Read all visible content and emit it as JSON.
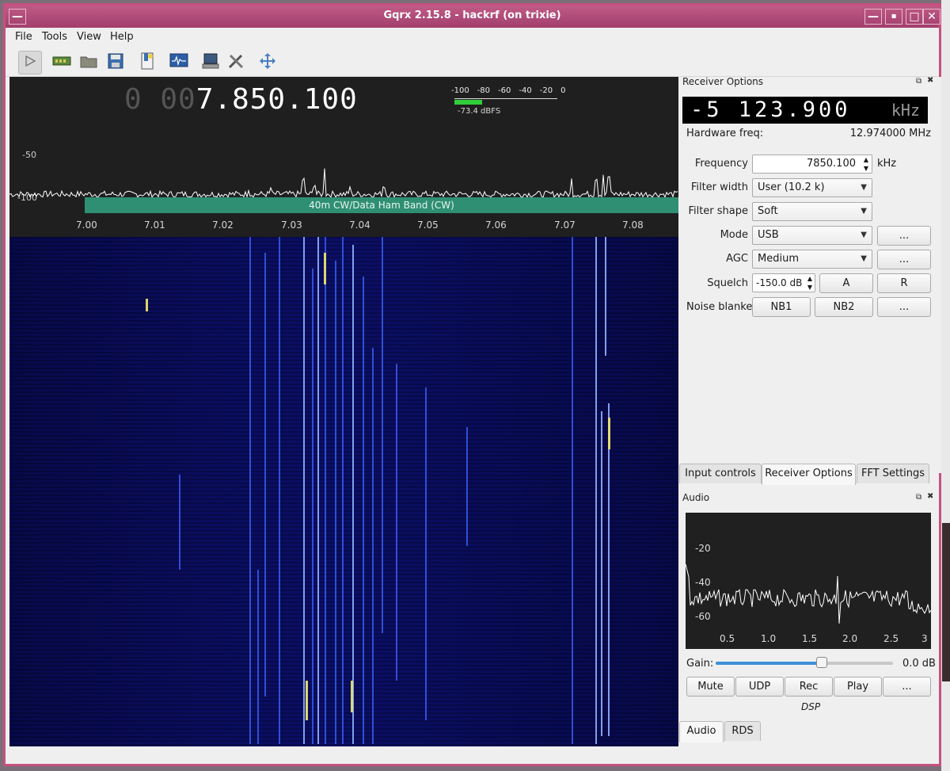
{
  "window": {
    "title": "Gqrx 2.15.8 - hackrf (on trixie)"
  },
  "menu": {
    "items": [
      "File",
      "Tools",
      "View",
      "Help"
    ]
  },
  "toolbar": {
    "icons": [
      "play-icon",
      "hardware-icon",
      "open-file-icon",
      "save-icon",
      "bookmark-icon",
      "scope-icon",
      "network-icon",
      "settings-icon",
      "fullscreen-icon"
    ]
  },
  "plot": {
    "frequency_dim": "0 00",
    "frequency_main": "7.850.100",
    "meter_scale": [
      "-100",
      "-80",
      "-60",
      "-40",
      "-20",
      "0"
    ],
    "meter_level": 0.27,
    "meter_text": "-73.4 dBFS",
    "db_labels": [
      "-50",
      "-100"
    ],
    "band_label": "40m CW/Data Ham Band (CW)",
    "freq_ticks": [
      "7.00",
      "7.01",
      "7.02",
      "7.03",
      "7.04",
      "7.05",
      "7.06",
      "7.07",
      "7.08"
    ]
  },
  "receiver": {
    "panel_title": "Receiver Options",
    "lcd_value": "-5 123.900",
    "lcd_unit": "kHz",
    "hardware_label": "Hardware freq:",
    "hardware_value": "12.974000 MHz",
    "frequency_label": "Frequency",
    "frequency_value": "7850.100",
    "frequency_unit": "kHz",
    "filter_width_label": "Filter width",
    "filter_width_value": "User (10.2 k)",
    "filter_shape_label": "Filter shape",
    "filter_shape_value": "Soft",
    "mode_label": "Mode",
    "mode_value": "USB",
    "agc_label": "AGC",
    "agc_value": "Medium",
    "squelch_label": "Squelch",
    "squelch_value": "-150.0 dB",
    "squelch_a": "A",
    "squelch_r": "R",
    "noise_label": "Noise blanker",
    "nb1": "NB1",
    "nb2": "NB2",
    "more": "..."
  },
  "dock_tabs": [
    "Input controls",
    "Receiver Options",
    "FFT Settings"
  ],
  "audio": {
    "panel_title": "Audio",
    "y_labels": [
      "-20",
      "-40",
      "-60"
    ],
    "x_labels": [
      "0.5",
      "1.0",
      "1.5",
      "2.0",
      "2.5",
      "3"
    ],
    "gain_label": "Gain:",
    "gain_value": "0.0 dB",
    "gain_level": 0.6,
    "buttons": [
      "Mute",
      "UDP",
      "Rec",
      "Play",
      "..."
    ],
    "dsp_label": "DSP",
    "tabs": [
      "Audio",
      "RDS"
    ]
  }
}
